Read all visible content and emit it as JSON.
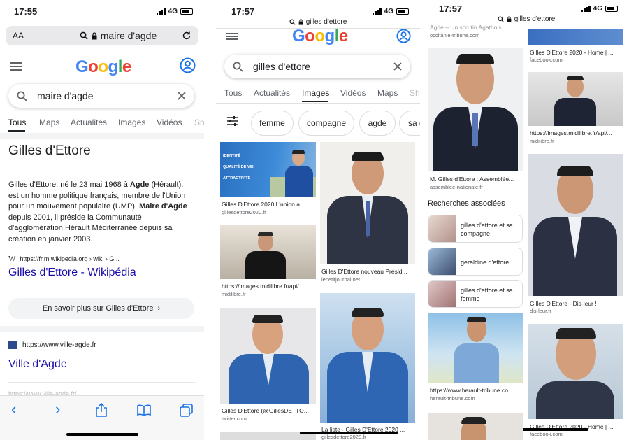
{
  "panel1": {
    "status": {
      "time": "17:55",
      "network": "4G"
    },
    "addressbar": {
      "aa": "AA",
      "query": "maire d'agde"
    },
    "search": {
      "query": "maire d'agde"
    },
    "tabs": [
      "Tous",
      "Maps",
      "Actualités",
      "Images",
      "Vidéos",
      "Sh"
    ],
    "entity": {
      "title": "Gilles d'Ettore",
      "desc1": "Gilles d'Ettore, né le 23 mai 1968 à ",
      "desc_agde": "Agde",
      "desc2": " (Hérault), est un homme politique français, membre de l'Union pour un mouvement populaire (UMP). ",
      "desc_maire": "Maire d'Agde",
      "desc3": " depuis 2001, il préside la Communauté d'agglomération Hérault Méditerranée depuis sa création en janvier 2003.",
      "wiki_url": "https://fr.m.wikipedia.org › wiki › G...",
      "wiki_title": "Gilles d'Ettore - Wikipédia",
      "more_button": "En savoir plus sur Gilles d'Ettore"
    },
    "result2": {
      "url": "https://www.ville-agde.fr",
      "title": "Ville d'Agde",
      "next": "https://www.ville-agde.fr/..."
    }
  },
  "panel2": {
    "status": {
      "time": "17:57",
      "network": "4G"
    },
    "url": "gilles d'ettore",
    "search": {
      "query": "gilles d'ettore"
    },
    "tabs": [
      "Tous",
      "Actualités",
      "Images",
      "Vidéos",
      "Maps",
      "Sh"
    ],
    "chips": [
      "femme",
      "compagne",
      "agde",
      "sa c"
    ],
    "banner": {
      "line1": "IDENTITÉ",
      "line2": "QUALITÉ DE VIE",
      "line3": "ATTRACTIVITÉ"
    },
    "images": [
      {
        "caption": "Gilles D'Ettore 2020 L'union a...",
        "source": "gillesdettore2020.fr"
      },
      {
        "caption": "Gilles D'Ettore nouveau Présid...",
        "source": "lepetitjournal.net"
      },
      {
        "caption": "https://images.midilibre.fr/api/...",
        "source": "midilibre.fr"
      },
      {
        "caption": "Gilles D'Ettore (@GillesDETTO...",
        "source": "twitter.com"
      },
      {
        "caption": "La liste - Gilles D'Ettore 2020 ...",
        "source": "gillesdettore2020.fr"
      }
    ]
  },
  "panel3": {
    "status": {
      "time": "17:57",
      "network": "4G"
    },
    "url": "gilles d'ettore",
    "images": [
      {
        "caption": "Agde – Un scrutin Agathois ...",
        "source": "occitanie-tribune.com"
      },
      {
        "caption": "Gilles D'Ettore 2020 - Home | ...",
        "source": "facebook.com"
      },
      {
        "caption": "M. Gilles d'Ettore : Assemblée...",
        "source": "assemblee-nationale.fr"
      },
      {
        "caption": "https://images.midilibre.fr/api/...",
        "source": "midilibre.fr"
      },
      {
        "caption": "Gilles D'Ettore - Dis-leur !",
        "source": "dis-leur.fr"
      },
      {
        "caption": "https://www.herault-tribune.co...",
        "source": "herault-tribune.com"
      },
      {
        "caption": "Gilles D'Ettore 2020 - Home | ...",
        "source": "facebook.com"
      }
    ],
    "related_title": "Recherches associées",
    "related": [
      "gilles d'ettore et sa compagne",
      "geraldine d'ettore",
      "gilles d'ettore et sa femme"
    ]
  },
  "colors": {
    "link": "#1a0dab",
    "google_blue": "#4285F4",
    "google_red": "#EA4335",
    "google_yellow": "#FBBC05",
    "google_green": "#34A853",
    "ios_blue": "#1a73e8"
  }
}
